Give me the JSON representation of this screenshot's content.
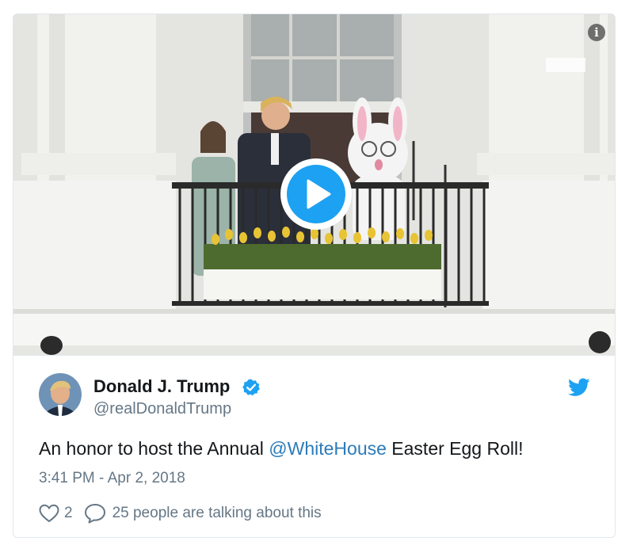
{
  "media": {
    "info_icon": "info-icon",
    "play_icon": "play-icon",
    "accent_color": "#1da1f2"
  },
  "tweet": {
    "author_name": "Donald J. Trump",
    "author_handle": "@realDonaldTrump",
    "verified_icon": "verified-badge-icon",
    "brand_icon": "twitter-bird-icon",
    "text_prefix": "An honor to host the Annual ",
    "mention": "@WhiteHouse",
    "text_suffix": " Easter Egg Roll!",
    "timestamp": "3:41 PM - Apr 2, 2018",
    "like_count": "2",
    "conversation_text": "25 people are talking about this",
    "link_color": "#2b7bb9",
    "secondary_text_color": "#657786"
  }
}
